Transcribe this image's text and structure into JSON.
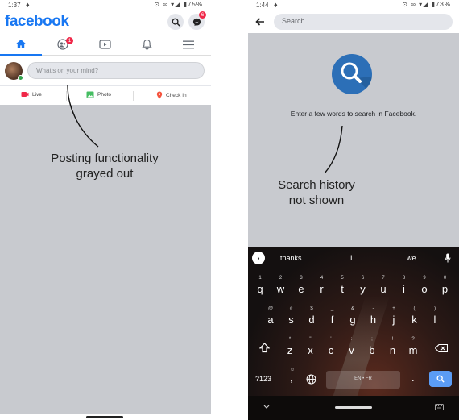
{
  "left": {
    "status": {
      "time": "1:37",
      "battery": "75%"
    },
    "logo": "facebook",
    "search_icon": "search-icon",
    "messenger_badge": "6",
    "tabs": [
      {
        "name": "home-icon",
        "active": true
      },
      {
        "name": "friends-icon",
        "badge": "1"
      },
      {
        "name": "watch-icon"
      },
      {
        "name": "notifications-icon"
      },
      {
        "name": "menu-icon"
      }
    ],
    "composer": {
      "placeholder": "What's on your mind?"
    },
    "actions": [
      {
        "label": "Live",
        "icon": "live-icon",
        "color": "#f02849"
      },
      {
        "label": "Photo",
        "icon": "photo-icon",
        "color": "#45bd62"
      },
      {
        "label": "Check In",
        "icon": "location-icon",
        "color": "#f5533d"
      }
    ],
    "annotation": {
      "line1": "Posting functionality",
      "line2": "grayed out"
    }
  },
  "right": {
    "status": {
      "time": "1:44",
      "battery": "73%"
    },
    "search": {
      "placeholder": "Search"
    },
    "hint": "Enter a few words to search in Facebook.",
    "annotation": {
      "line1": "Search history",
      "line2": "not shown"
    },
    "keyboard": {
      "suggestions": [
        "thanks",
        "I",
        "we"
      ],
      "row1": [
        [
          "q",
          "1"
        ],
        [
          "w",
          "2"
        ],
        [
          "e",
          "3"
        ],
        [
          "r",
          "4"
        ],
        [
          "t",
          "5"
        ],
        [
          "y",
          "6"
        ],
        [
          "u",
          "7"
        ],
        [
          "i",
          "8"
        ],
        [
          "o",
          "9"
        ],
        [
          "p",
          "0"
        ]
      ],
      "row2": [
        [
          "a",
          "@"
        ],
        [
          "s",
          "#"
        ],
        [
          "d",
          "$"
        ],
        [
          "f",
          "_"
        ],
        [
          "g",
          "&"
        ],
        [
          "h",
          "-"
        ],
        [
          "j",
          "+"
        ],
        [
          "k",
          "("
        ],
        [
          "l",
          ")"
        ]
      ],
      "row3": [
        [
          "z",
          "*"
        ],
        [
          "x",
          "\""
        ],
        [
          "c",
          "'"
        ],
        [
          "v",
          ":"
        ],
        [
          "b",
          ";"
        ],
        [
          "n",
          "!"
        ],
        [
          "m",
          "?"
        ]
      ],
      "symbols_label": "?123",
      "comma": ",",
      "period": ".",
      "space_label": "EN • FR"
    }
  },
  "colors": {
    "brand": "#1877f2",
    "gray_overlay": "#c8cacf",
    "search_circle": "#2c6fb7"
  }
}
